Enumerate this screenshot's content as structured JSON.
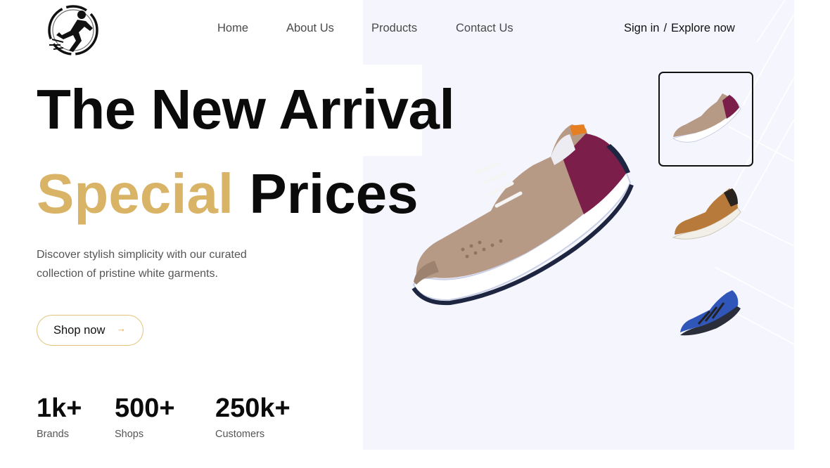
{
  "nav": {
    "links": [
      {
        "label": "Home"
      },
      {
        "label": "About Us"
      },
      {
        "label": "Products"
      },
      {
        "label": "Contact Us"
      }
    ],
    "sign_in": "Sign in",
    "separator": "/",
    "explore": "Explore now"
  },
  "hero": {
    "title": "The New Arrival",
    "subtitle_highlight": "Special",
    "subtitle_rest": "Prices",
    "description": "Discover stylish simplicity with our curated collection of pristine white garments.",
    "cta_label": "Shop now",
    "cta_arrow": "→"
  },
  "stats": [
    {
      "value": "1k+",
      "label": "Brands"
    },
    {
      "value": "500+",
      "label": "Shops"
    },
    {
      "value": "250k+",
      "label": "Customers"
    }
  ],
  "thumbnails": [
    {
      "name": "beige-purple-sneaker",
      "selected": true
    },
    {
      "name": "tan-leather-sneaker",
      "selected": false
    },
    {
      "name": "blue-hiking-shoe",
      "selected": false
    }
  ],
  "colors": {
    "accent_gold": "#d9b366",
    "button_border": "#e3c37b",
    "panel_bg": "#f4f5fd",
    "text_dark": "#0b0b0b"
  },
  "icons": {
    "logo": "runner-logo-icon",
    "cta_arrow": "arrow-right-icon"
  }
}
